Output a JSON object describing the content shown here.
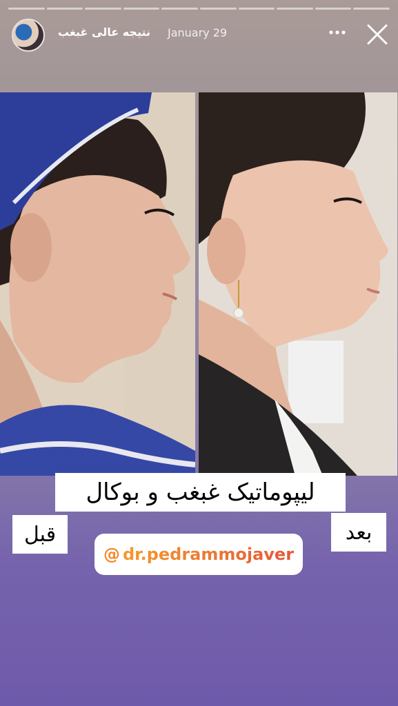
{
  "story": {
    "progress_segments": 10,
    "user_name": "نتیجه عالی غبغب",
    "date": "January 29"
  },
  "content": {
    "title": "لیپوماتیک غبغب و بوکال",
    "label_before": "قبل",
    "label_after": "بعد",
    "mention_symbol": "@",
    "mention_handle": "dr.pedrammojaver"
  },
  "icons": [
    "more-icon",
    "close-icon",
    "mention-icon"
  ],
  "colors": {
    "background_top": "#a99b97",
    "background_bottom": "#6e5aaa",
    "mention_gradient_start": "#f59a2d",
    "mention_gradient_end": "#e5573a"
  }
}
